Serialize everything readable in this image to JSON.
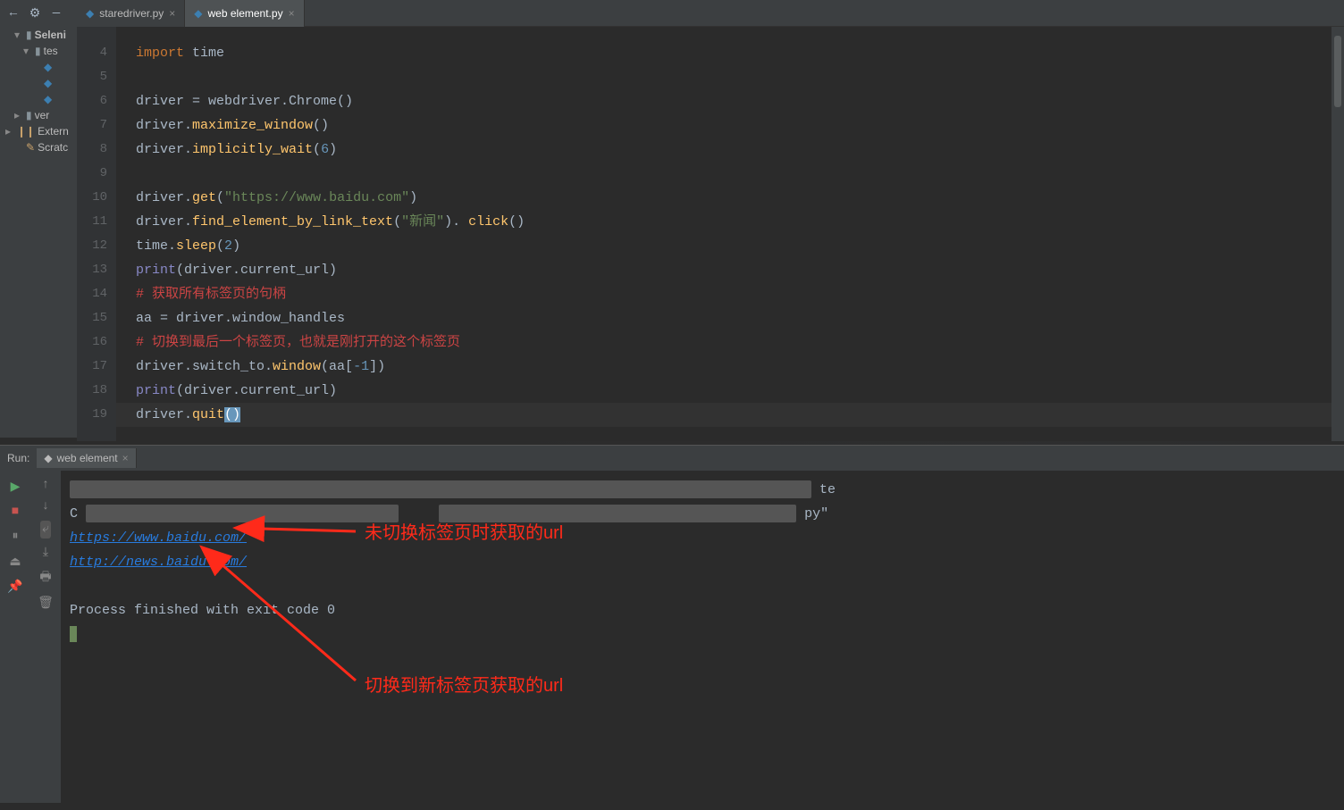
{
  "tabs": [
    {
      "label": "staredriver.py",
      "active": false
    },
    {
      "label": "web element.py",
      "active": true
    }
  ],
  "project_tree": {
    "items": [
      {
        "label": "Seleni",
        "type": "folder",
        "depth": 0,
        "arrow": "▾",
        "bold": true
      },
      {
        "label": "tes",
        "type": "folder",
        "depth": 1,
        "arrow": "▾"
      },
      {
        "label": "",
        "type": "py",
        "depth": 2
      },
      {
        "label": "",
        "type": "py",
        "depth": 2
      },
      {
        "label": "",
        "type": "py",
        "depth": 2
      },
      {
        "label": "ver",
        "type": "folder",
        "depth": 0,
        "arrow": "▸"
      },
      {
        "label": "Extern",
        "type": "lib",
        "depth": -1,
        "arrow": "▸"
      },
      {
        "label": "Scratc",
        "type": "scratch",
        "depth": 0
      }
    ]
  },
  "code_lines": [
    {
      "n": 4,
      "tokens": [
        [
          "kw",
          "import"
        ],
        [
          "ident",
          " time"
        ]
      ]
    },
    {
      "n": 5,
      "tokens": []
    },
    {
      "n": 6,
      "tokens": [
        [
          "ident",
          "driver = webdriver.Chrome"
        ],
        [
          "ident",
          "()"
        ]
      ]
    },
    {
      "n": 7,
      "tokens": [
        [
          "ident",
          "driver."
        ],
        [
          "fn",
          "maximize_window"
        ],
        [
          "ident",
          "()"
        ]
      ]
    },
    {
      "n": 8,
      "tokens": [
        [
          "ident",
          "driver."
        ],
        [
          "fn",
          "implicitly_wait"
        ],
        [
          "ident",
          "("
        ],
        [
          "num",
          "6"
        ],
        [
          "ident",
          ")"
        ]
      ]
    },
    {
      "n": 9,
      "tokens": []
    },
    {
      "n": 10,
      "tokens": [
        [
          "ident",
          "driver."
        ],
        [
          "fn",
          "get"
        ],
        [
          "ident",
          "("
        ],
        [
          "str",
          "\"https://www.baidu.com\""
        ],
        [
          "ident",
          ")"
        ]
      ]
    },
    {
      "n": 11,
      "tokens": [
        [
          "ident",
          "driver."
        ],
        [
          "fn",
          "find_element_by_link_text"
        ],
        [
          "ident",
          "("
        ],
        [
          "str",
          "\"新闻\""
        ],
        [
          "ident",
          "). "
        ],
        [
          "fn",
          "click"
        ],
        [
          "ident",
          "()"
        ]
      ]
    },
    {
      "n": 12,
      "tokens": [
        [
          "ident",
          "time."
        ],
        [
          "fn",
          "sleep"
        ],
        [
          "ident",
          "("
        ],
        [
          "num",
          "2"
        ],
        [
          "ident",
          ")"
        ]
      ]
    },
    {
      "n": 13,
      "tokens": [
        [
          "builtin",
          "print"
        ],
        [
          "ident",
          "(driver.current_url)"
        ]
      ]
    },
    {
      "n": 14,
      "tokens": [
        [
          "cmt",
          "# 获取所有标签页的句柄"
        ]
      ]
    },
    {
      "n": 15,
      "tokens": [
        [
          "ident",
          "aa = driver.window_handles"
        ]
      ]
    },
    {
      "n": 16,
      "tokens": [
        [
          "cmt",
          "# 切换到最后一个标签页，也就是刚打开的这个标签页"
        ]
      ]
    },
    {
      "n": 17,
      "tokens": [
        [
          "ident",
          "driver.switch_to."
        ],
        [
          "fn",
          "window"
        ],
        [
          "ident",
          "(aa["
        ],
        [
          "num",
          "-1"
        ],
        [
          "ident",
          "])"
        ]
      ]
    },
    {
      "n": 18,
      "tokens": [
        [
          "builtin",
          "print"
        ],
        [
          "ident",
          "(driver.current_url)"
        ]
      ]
    },
    {
      "n": 19,
      "tokens": [
        [
          "ident",
          "driver."
        ],
        [
          "fn",
          "quit"
        ],
        [
          "caret",
          "()"
        ]
      ],
      "current": true
    }
  ],
  "run": {
    "label": "Run:",
    "tab_label": "web element",
    "censored_tail_1": "te",
    "censored_prefix_2": "C",
    "censored_tail_2": "py\"",
    "url1": "https://www.baidu.com/",
    "url2": "http://news.baidu.com/",
    "exit_line": "Process finished with exit code 0"
  },
  "annotations": {
    "a1": "未切换标签页时获取的url",
    "a2": "切换到新标签页获取的url"
  }
}
